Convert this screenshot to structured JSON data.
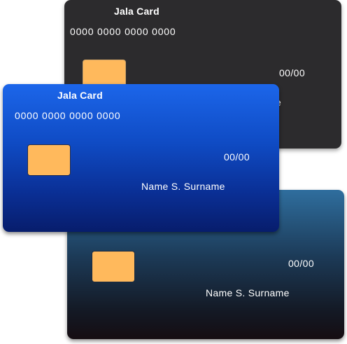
{
  "cards": {
    "back": {
      "brand": "Jala Card",
      "number": "0000 0000 0000 0000",
      "expiry": "00/00",
      "holder_fragment": "e"
    },
    "front": {
      "brand": "Jala Card",
      "number": "0000 0000 0000 0000",
      "expiry": "00/00",
      "holder": "Name S. Surname"
    },
    "bottom": {
      "expiry": "00/00",
      "holder": "Name S. Surname"
    }
  },
  "colors": {
    "chip": "#ffb95c",
    "back_card": "#2c2b2d",
    "front_card_top": "#1c66ea",
    "front_card_bottom": "#071d6c",
    "bottom_card_top": "#2f6e9e",
    "bottom_card_bottom": "#150d12"
  }
}
